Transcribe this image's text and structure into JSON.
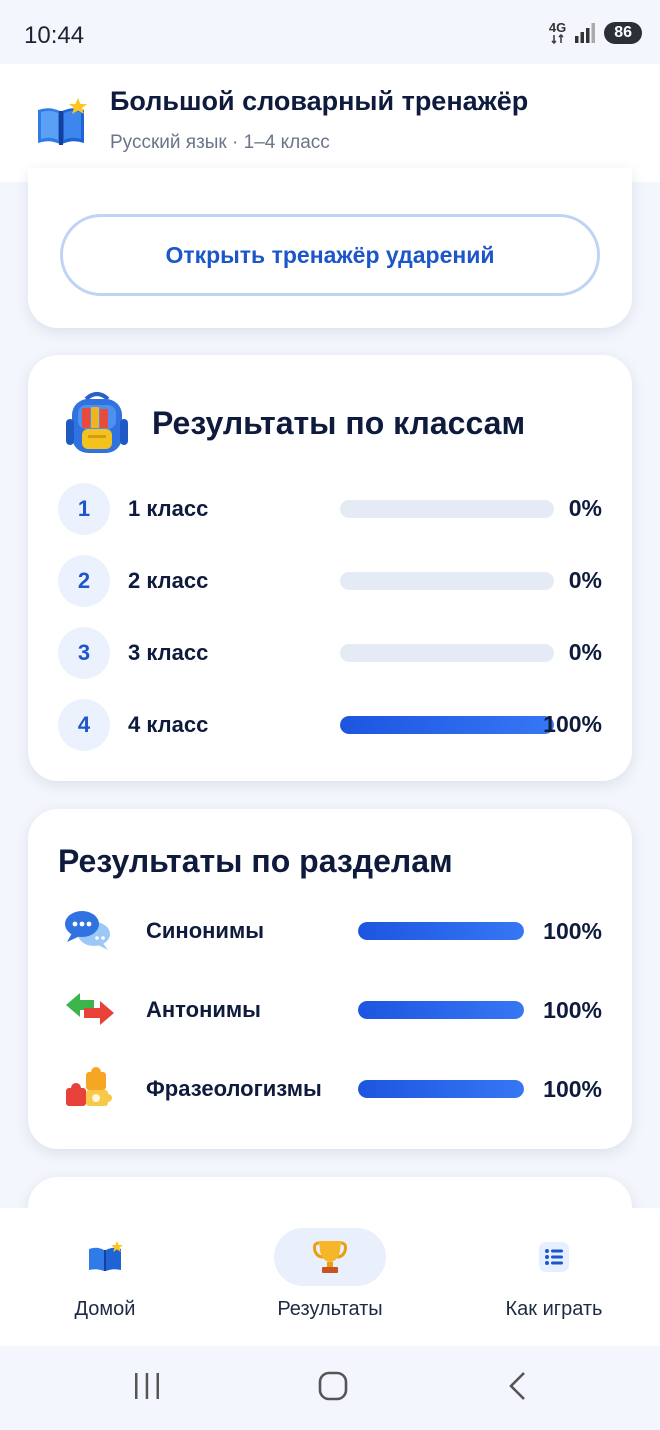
{
  "status_bar": {
    "time": "10:44",
    "network": "4G",
    "battery": "86",
    "icons": [
      "network-4g-icon",
      "signal-icon",
      "battery-icon"
    ]
  },
  "header": {
    "title": "Большой словарный тренажёр",
    "subtitle": "Русский язык · 1–4 класс",
    "icon": "open-book-star-icon"
  },
  "top_card": {
    "button_label": "Открыть тренажёр ударений"
  },
  "classes_card": {
    "title": "Результаты по классам",
    "icon": "backpack-icon",
    "rows": [
      {
        "num": "1",
        "label": "1 класс",
        "percent_text": "0%",
        "progress": 0
      },
      {
        "num": "2",
        "label": "2 класс",
        "percent_text": "0%",
        "progress": 0
      },
      {
        "num": "3",
        "label": "3 класс",
        "percent_text": "0%",
        "progress": 0
      },
      {
        "num": "4",
        "label": "4 класс",
        "percent_text": "100%",
        "progress": 100
      }
    ]
  },
  "sections_card": {
    "title": "Результаты по разделам",
    "rows": [
      {
        "label": "Синонимы",
        "percent_text": "100%",
        "progress": 100,
        "icon": "speech-bubbles-icon"
      },
      {
        "label": "Антонимы",
        "percent_text": "100%",
        "progress": 100,
        "icon": "opposite-arrows-icon"
      },
      {
        "label": "Фразеологизмы",
        "percent_text": "100%",
        "progress": 100,
        "icon": "puzzle-icon"
      }
    ]
  },
  "bottom_nav": {
    "items": [
      {
        "label": "Домой",
        "icon": "book-icon",
        "active": false
      },
      {
        "label": "Результаты",
        "icon": "trophy-icon",
        "active": true
      },
      {
        "label": "Как играть",
        "icon": "list-icon",
        "active": false
      }
    ]
  },
  "system_nav": {
    "icons": [
      "recent-apps-icon",
      "home-icon",
      "back-icon"
    ]
  },
  "colors": {
    "accent": "#1d56c9",
    "progress_fill": "#2563eb",
    "progress_track": "#e5ebf5",
    "background": "#f3f6fc"
  }
}
